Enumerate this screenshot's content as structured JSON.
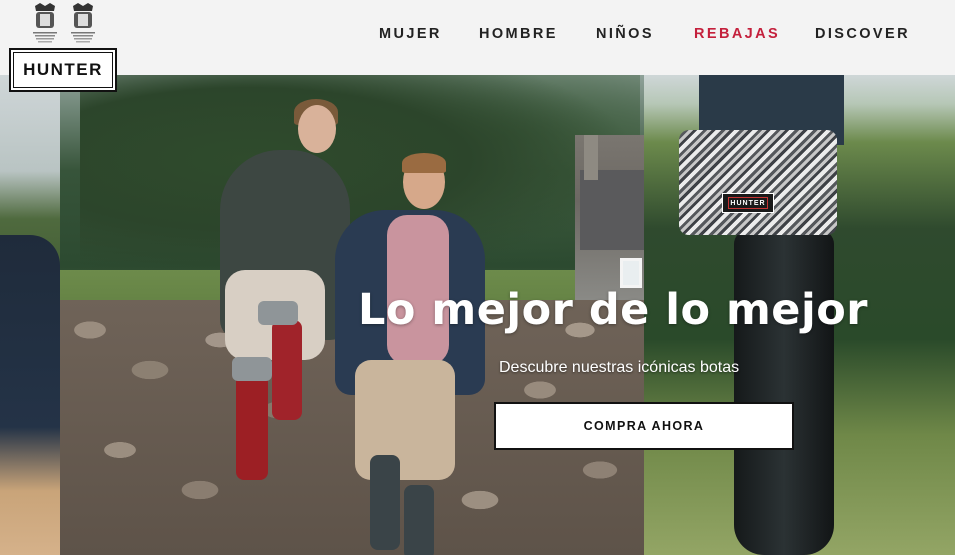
{
  "brand": {
    "logo_text": "HUNTER",
    "crest_icons": [
      "royal-crest-icon",
      "royal-crest-icon"
    ]
  },
  "nav": {
    "items": [
      {
        "label": "MUJER"
      },
      {
        "label": "HOMBRE"
      },
      {
        "label": "NIÑOS"
      },
      {
        "label": "REBAJAS"
      },
      {
        "label": "DISCOVER"
      }
    ]
  },
  "hero": {
    "title": "Lo mejor de lo mejor",
    "subtitle": "Descubre nuestras icónicas botas",
    "cta_label": "COMPRA AHORA",
    "boot_label": "HUNTER"
  },
  "colors": {
    "header_bg": "#f3f3f3",
    "sale": "#c4203c",
    "text": "#222222",
    "cta_bg": "#ffffff"
  }
}
